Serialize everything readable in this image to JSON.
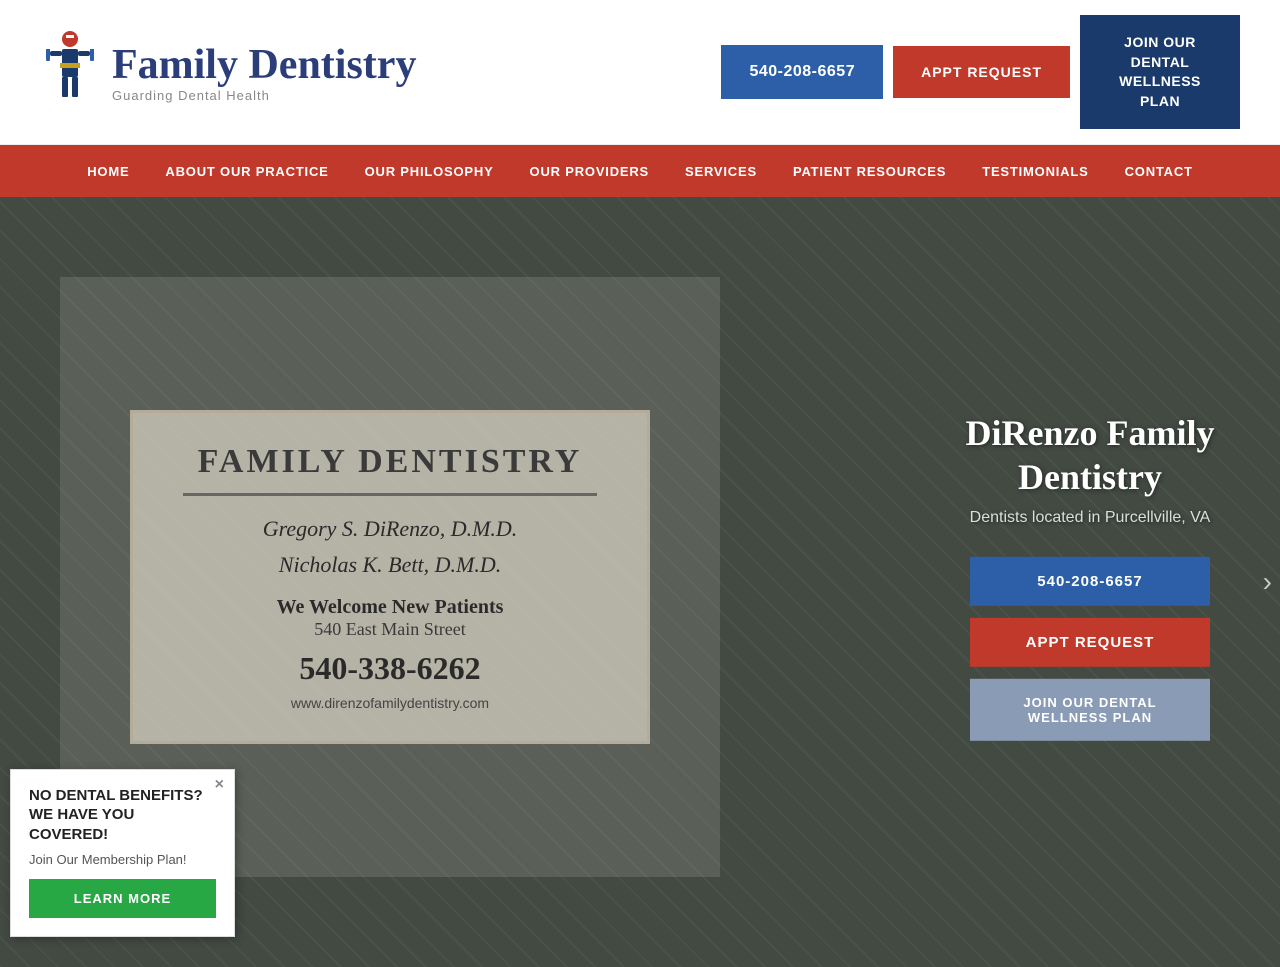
{
  "site": {
    "title": "Family Dentistry",
    "tagline": "Guarding Dental Health"
  },
  "header": {
    "phone": "540-208-6657",
    "appt_label": "APPT REQUEST",
    "wellness_label": "JOIN OUR DENTAL WELLNESS PLAN"
  },
  "nav": {
    "items": [
      {
        "label": "HOME"
      },
      {
        "label": "ABOUT OUR PRACTICE"
      },
      {
        "label": "OUR PHILOSOPHY"
      },
      {
        "label": "OUR PROVIDERS"
      },
      {
        "label": "SERVICES"
      },
      {
        "label": "PATIENT RESOURCES"
      },
      {
        "label": "TESTIMONIALS"
      },
      {
        "label": "CONTACT"
      }
    ]
  },
  "hero": {
    "sign": {
      "title": "FAMILY DENTISTRY",
      "doctor1": "Gregory S. DiRenzo, D.M.D.",
      "doctor2": "Nicholas K. Bett, D.M.D.",
      "welcome": "We Welcome New Patients",
      "address": "540 East Main Street",
      "phone": "540-338-6262",
      "website": "www.direnzofamilydentistry.com"
    },
    "overlay": {
      "title": "DiRenzo Family Dentistry",
      "subtitle": "Dentists located in Purcellville, VA",
      "phone_btn": "540-208-6657",
      "appt_btn": "APPT REQUEST",
      "wellness_btn": "JOIN OUR DENTAL WELLNESS PLAN"
    }
  },
  "popup": {
    "title": "NO DENTAL BENEFITS? WE HAVE YOU COVERED!",
    "subtitle": "Join Our Membership Plan!",
    "btn_label": "LEARN MORE",
    "close": "×"
  }
}
